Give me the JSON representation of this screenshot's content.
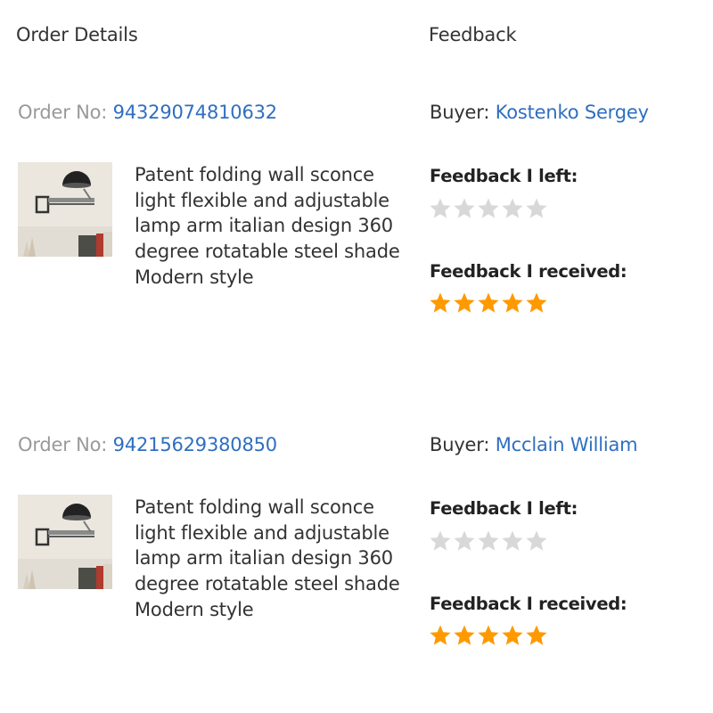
{
  "header": {
    "order_details": "Order Details",
    "feedback": "Feedback"
  },
  "orders": [
    {
      "order_no_label": "Order No:",
      "order_no": "94329074810632",
      "buyer_label": "Buyer:",
      "buyer_name": "Kostenko Sergey",
      "product_title": "Patent folding wall sconce light flexible and adjustable lamp arm italian design 360 degree rotatable steel shade Modern style",
      "feedback_left_label": "Feedback I left:",
      "feedback_left_stars": 0,
      "feedback_received_label": "Feedback I received:",
      "feedback_received_stars": 5
    },
    {
      "order_no_label": "Order No:",
      "order_no": "94215629380850",
      "buyer_label": "Buyer:",
      "buyer_name": "Mcclain William",
      "product_title": "Patent folding wall sconce light flexible and adjustable lamp arm italian design 360 degree rotatable steel shade Modern style",
      "feedback_left_label": "Feedback I left:",
      "feedback_left_stars": 0,
      "feedback_received_label": "Feedback I received:",
      "feedback_received_stars": 5
    }
  ],
  "icons": {
    "star_filled": "star-filled-icon",
    "star_empty": "star-empty-icon",
    "product_thumbnail": "wall-sconce-lamp-image"
  },
  "colors": {
    "link": "#2f6fbf",
    "muted": "#999999",
    "star_filled": "#ff9900",
    "star_empty": "#d8d8d8"
  }
}
